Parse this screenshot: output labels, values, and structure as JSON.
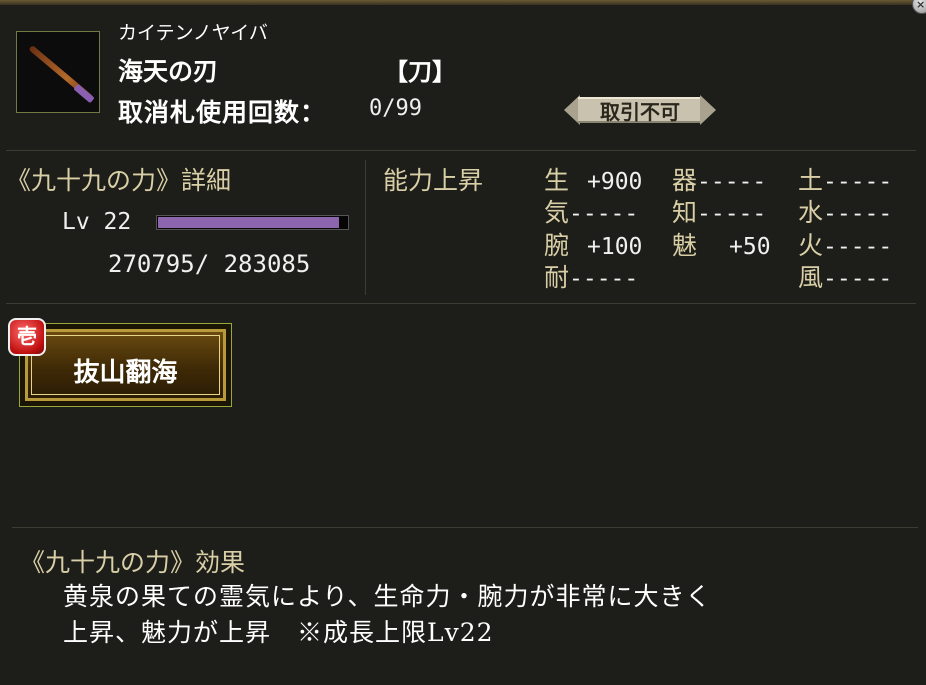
{
  "item": {
    "kana": "カイテンノヤイバ",
    "name": "海天の刃",
    "type": "【刀】",
    "usage_label": "取消札使用回数：",
    "usage_value": "0/99",
    "trade_status": "取引不可"
  },
  "detail": {
    "title": "《九十九の力》詳細",
    "level_label": "Lv 22",
    "exp_text": "270795/  283085",
    "exp_progress": 0.9566
  },
  "ability": {
    "title": "能力上昇",
    "stats": {
      "sei": {
        "key": "生",
        "value": "+900"
      },
      "ki": {
        "key": "気",
        "value": "-----"
      },
      "wan": {
        "key": "腕",
        "value": "+100"
      },
      "tai": {
        "key": "耐",
        "value": "-----"
      },
      "utsuwa": {
        "key": "器",
        "value": "-----"
      },
      "chi": {
        "key": "知",
        "value": "-----"
      },
      "mi": {
        "key": "魅",
        "value": "+50"
      },
      "tsuchi": {
        "key": "土",
        "value": "-----"
      },
      "mizu": {
        "key": "水",
        "value": "-----"
      },
      "hi": {
        "key": "火",
        "value": "-----"
      },
      "kaze": {
        "key": "風",
        "value": "-----"
      }
    }
  },
  "skill": {
    "rank": "壱",
    "label": "抜山翻海"
  },
  "effect": {
    "title": "《九十九の力》効果",
    "line1": "黄泉の果ての霊気により、生命力・腕力が非常に大きく",
    "line2": "上昇、魅力が上昇　※成長上限Lv22"
  },
  "colors": {
    "background": "#1d1d19",
    "label_gold": "#d9cfa6",
    "exp_bar": "#8d64ae",
    "skill_frame": "#b99a3a",
    "rank_red": "#c01010"
  }
}
